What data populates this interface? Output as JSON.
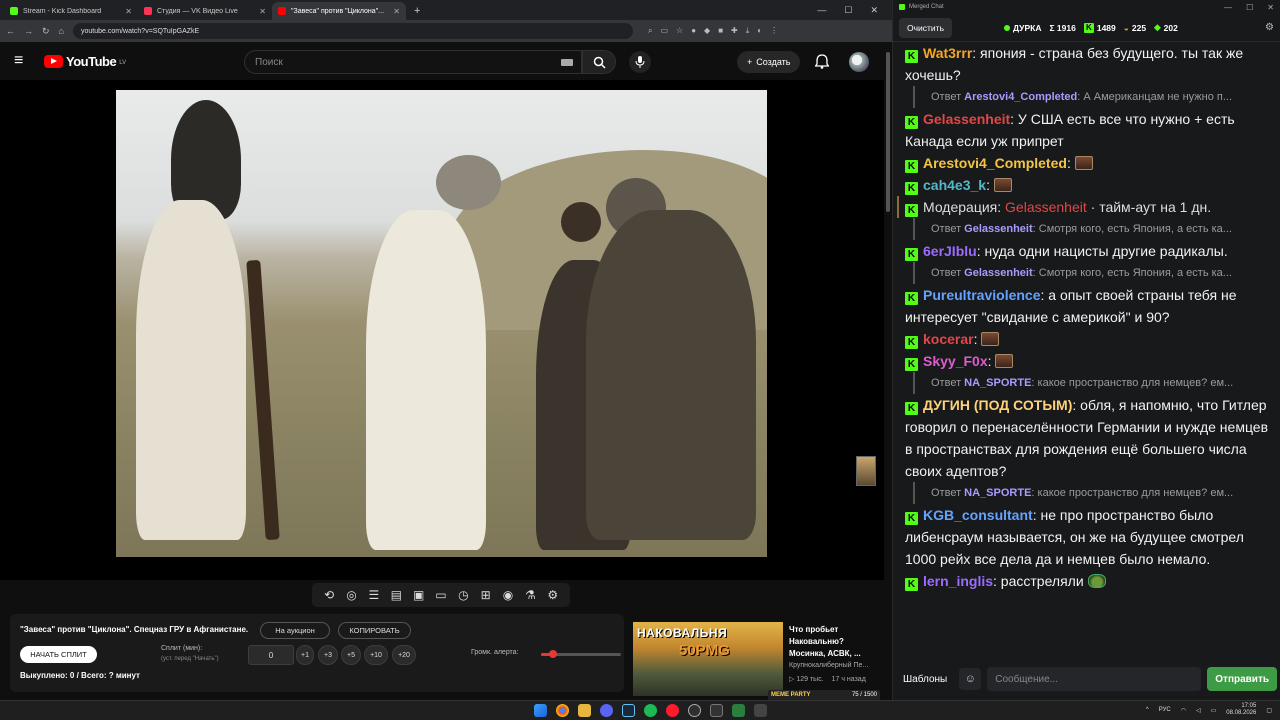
{
  "browser": {
    "tabs": [
      {
        "label": "Stream - Kick Dashboard",
        "color": "#53fc18"
      },
      {
        "label": "Студия — VK Видео Live",
        "color": "#ff3355"
      },
      {
        "label": "\"Завеса\" против \"Циклона\"...",
        "color": "#ff0000"
      }
    ],
    "new_tab": "+",
    "url": "youtube.com/watch?v=SQTuIpGAZkE"
  },
  "youtube": {
    "logo": "YouTube",
    "country": "LV",
    "search_placeholder": "Поиск",
    "create_label": "Создать"
  },
  "panel": {
    "title": "\"Завеса\" против \"Циклона\". Спецназ ГРУ в Афганистане.",
    "auction_btn": "На аукцион",
    "copy_btn": "КОПИРОВАТЬ",
    "start_btn": "НАЧАТЬ СПЛИТ",
    "split_label": "Сплит (мин):",
    "split_hint": "(уст. перед \"Начать\")",
    "split_value": "0",
    "increments": [
      "+1",
      "+3",
      "+5",
      "+10",
      "+20"
    ],
    "alert_label": "Громк. алерта:",
    "alert_volume": 0.15,
    "bought": "Выкуплено: 0 / Всего: ? минут"
  },
  "recommendation": {
    "thumb_line1": "НАКОВАЛЬНЯ",
    "thumb_line2": "50PMG",
    "badge": "MEME PARTY",
    "title": "Что пробьет Наковальню? Мосинка, АСВК, ...",
    "channel": "Крупнокалиберный Пе...",
    "views": "129 тыс.",
    "age": "17 ч назад",
    "counter": "75 / 1500"
  },
  "chat": {
    "window_title": "Merged Chat",
    "clear_btn": "Очистить",
    "channel": "ДУРКА",
    "sigma": "Σ 1916",
    "kick_count": "1489",
    "stat2": "225",
    "stat3": "202",
    "messages": [
      {
        "type": "msg",
        "user": "Wat3rrr",
        "color": "#f5a623",
        "text": ": япония - страна без будущего. ты так же хочешь?"
      },
      {
        "type": "reply",
        "prefix": "Ответ",
        "user": "Arestovi4_Completed",
        "text": ": А Американцам не нужно п..."
      },
      {
        "type": "msg",
        "user": "Gelassenheit",
        "color": "#e04848",
        "text": ": У США есть все что нужно + есть Канада если уж припрет"
      },
      {
        "type": "emote",
        "user": "Arestovi4_Completed",
        "color": "#f5c542",
        "text": ":"
      },
      {
        "type": "emote",
        "user": "cah4e3_k",
        "color": "#53b8c9",
        "text": ":"
      },
      {
        "type": "mod",
        "prefix": "Модерация:",
        "user": "Gelassenheit",
        "text": " · тайм-аут на 1 дн."
      },
      {
        "type": "reply",
        "prefix": "Ответ",
        "user": "Gelassenheit",
        "text": ": Смотря кого, есть Япония, а есть ка..."
      },
      {
        "type": "msg",
        "user": "6erJIblu",
        "color": "#9c6cff",
        "text": ": нуда одни нацисты другие радикалы."
      },
      {
        "type": "reply",
        "prefix": "Ответ",
        "user": "Gelassenheit",
        "text": ": Смотря кого, есть Япония, а есть ка..."
      },
      {
        "type": "msg",
        "user": "Pureultraviolence",
        "color": "#63a3ff",
        "text": ": а опыт своей страны тебя не интересует \"свидание с америкой\" и 90?"
      },
      {
        "type": "emote",
        "user": "kocerar",
        "color": "#e04848",
        "text": ":"
      },
      {
        "type": "emote",
        "user": "Skyy_F0x",
        "color": "#e05bd0",
        "text": ":"
      },
      {
        "type": "reply",
        "prefix": "Ответ",
        "user": "NA_SPORTE",
        "text": ": какое пространство для немцев? ем..."
      },
      {
        "type": "msg",
        "user": "ДУГИН (ПОД СОТЫМ)",
        "color": "#ffd27a",
        "text": ": обля, я напомню, что Гитлер говорил о перенаселённости Германии и нужде немцев в пространствах для рождения ещё большего числа своих адептов?"
      },
      {
        "type": "reply",
        "prefix": "Ответ",
        "user": "NA_SPORTE",
        "text": ": какое пространство для немцев? ем..."
      },
      {
        "type": "msg",
        "user": "KGB_consultant",
        "color": "#63a3ff",
        "text": ": не про пространство было либенсраум называется, он же на будущее смотрел 1000 рейх все дела да и немцев было немало."
      },
      {
        "type": "emote",
        "user": "lern_inglis",
        "color": "#9c6cff",
        "text": ": расстреляли",
        "frog": true
      }
    ],
    "templates_btn": "Шаблоны",
    "input_placeholder": "Сообщение...",
    "send_btn": "Отправить"
  },
  "taskbar": {
    "lang": "РУС",
    "time": "17:05",
    "date": "08.08.2026"
  }
}
